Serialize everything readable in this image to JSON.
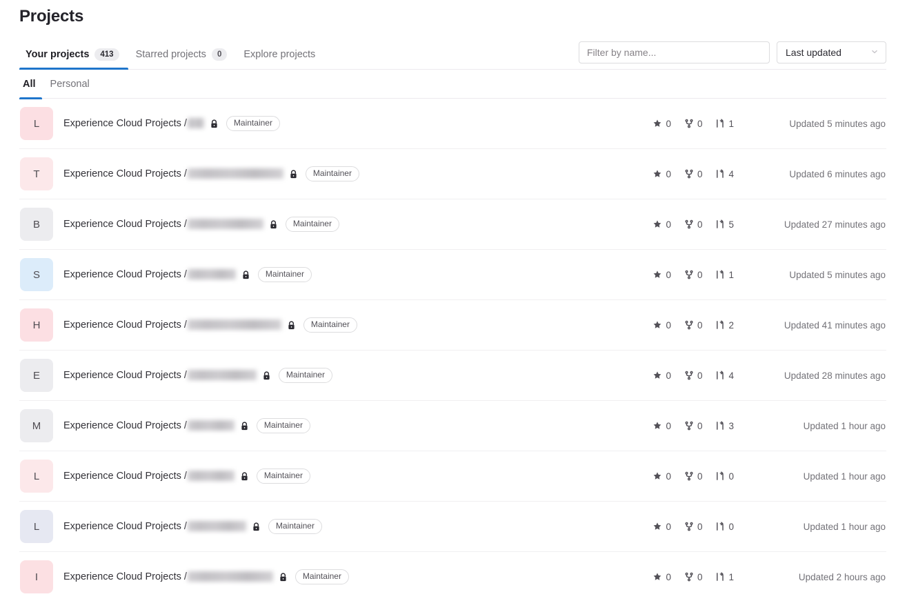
{
  "page": {
    "title": "Projects"
  },
  "tabs": [
    {
      "label": "Your projects",
      "count": "413",
      "active": true
    },
    {
      "label": "Starred projects",
      "count": "0",
      "active": false
    },
    {
      "label": "Explore projects",
      "count": "",
      "active": false
    }
  ],
  "search": {
    "placeholder": "Filter by name...",
    "value": ""
  },
  "sort": {
    "selected": "Last updated",
    "icon": "chevron-down-icon"
  },
  "subtabs": [
    {
      "label": "All",
      "active": true
    },
    {
      "label": "Personal",
      "active": false
    }
  ],
  "icons": {
    "star": "star-icon",
    "fork": "fork-icon",
    "merge_request": "merge-request-icon",
    "lock": "lock-icon"
  },
  "colors": {
    "accent": "#1f75cb",
    "text": "#333238",
    "muted": "#737278",
    "border": "#dcdcde",
    "row_border": "#f0eff1"
  },
  "projects": [
    {
      "avatar_letter": "L",
      "avatar_color": "#fcdfe3",
      "namespace": "Experience Cloud Projects /",
      "name_redacted_width": 24,
      "role": "Maintainer",
      "visibility": "private",
      "stars": "0",
      "forks": "0",
      "merge_requests": "1",
      "updated": "Updated 5 minutes ago"
    },
    {
      "avatar_letter": "T",
      "avatar_color": "#fce8ea",
      "namespace": "Experience Cloud Projects /",
      "name_redacted_width": 139,
      "role": "Maintainer",
      "visibility": "private",
      "stars": "0",
      "forks": "0",
      "merge_requests": "4",
      "updated": "Updated 6 minutes ago"
    },
    {
      "avatar_letter": "B",
      "avatar_color": "#ececef",
      "namespace": "Experience Cloud Projects /",
      "name_redacted_width": 110,
      "role": "Maintainer",
      "visibility": "private",
      "stars": "0",
      "forks": "0",
      "merge_requests": "5",
      "updated": "Updated 27 minutes ago"
    },
    {
      "avatar_letter": "S",
      "avatar_color": "#dcecfa",
      "namespace": "Experience Cloud Projects /",
      "name_redacted_width": 70,
      "role": "Maintainer",
      "visibility": "private",
      "stars": "0",
      "forks": "0",
      "merge_requests": "1",
      "updated": "Updated 5 minutes ago"
    },
    {
      "avatar_letter": "H",
      "avatar_color": "#fcdfe3",
      "namespace": "Experience Cloud Projects /",
      "name_redacted_width": 136,
      "role": "Maintainer",
      "visibility": "private",
      "stars": "0",
      "forks": "0",
      "merge_requests": "2",
      "updated": "Updated 41 minutes ago"
    },
    {
      "avatar_letter": "E",
      "avatar_color": "#ececef",
      "namespace": "Experience Cloud Projects /",
      "name_redacted_width": 100,
      "role": "Maintainer",
      "visibility": "private",
      "stars": "0",
      "forks": "0",
      "merge_requests": "4",
      "updated": "Updated 28 minutes ago"
    },
    {
      "avatar_letter": "M",
      "avatar_color": "#ececef",
      "namespace": "Experience Cloud Projects /",
      "name_redacted_width": 68,
      "role": "Maintainer",
      "visibility": "private",
      "stars": "0",
      "forks": "0",
      "merge_requests": "3",
      "updated": "Updated 1 hour ago"
    },
    {
      "avatar_letter": "L",
      "avatar_color": "#fce8ea",
      "namespace": "Experience Cloud Projects /",
      "name_redacted_width": 68,
      "role": "Maintainer",
      "visibility": "private",
      "stars": "0",
      "forks": "0",
      "merge_requests": "0",
      "updated": "Updated 1 hour ago"
    },
    {
      "avatar_letter": "L",
      "avatar_color": "#e6e8f2",
      "namespace": "Experience Cloud Projects /",
      "name_redacted_width": 85,
      "role": "Maintainer",
      "visibility": "private",
      "stars": "0",
      "forks": "0",
      "merge_requests": "0",
      "updated": "Updated 1 hour ago"
    },
    {
      "avatar_letter": "I",
      "avatar_color": "#fce0e3",
      "namespace": "Experience Cloud Projects /",
      "name_redacted_width": 124,
      "role": "Maintainer",
      "visibility": "private",
      "stars": "0",
      "forks": "0",
      "merge_requests": "1",
      "updated": "Updated 2 hours ago"
    }
  ]
}
